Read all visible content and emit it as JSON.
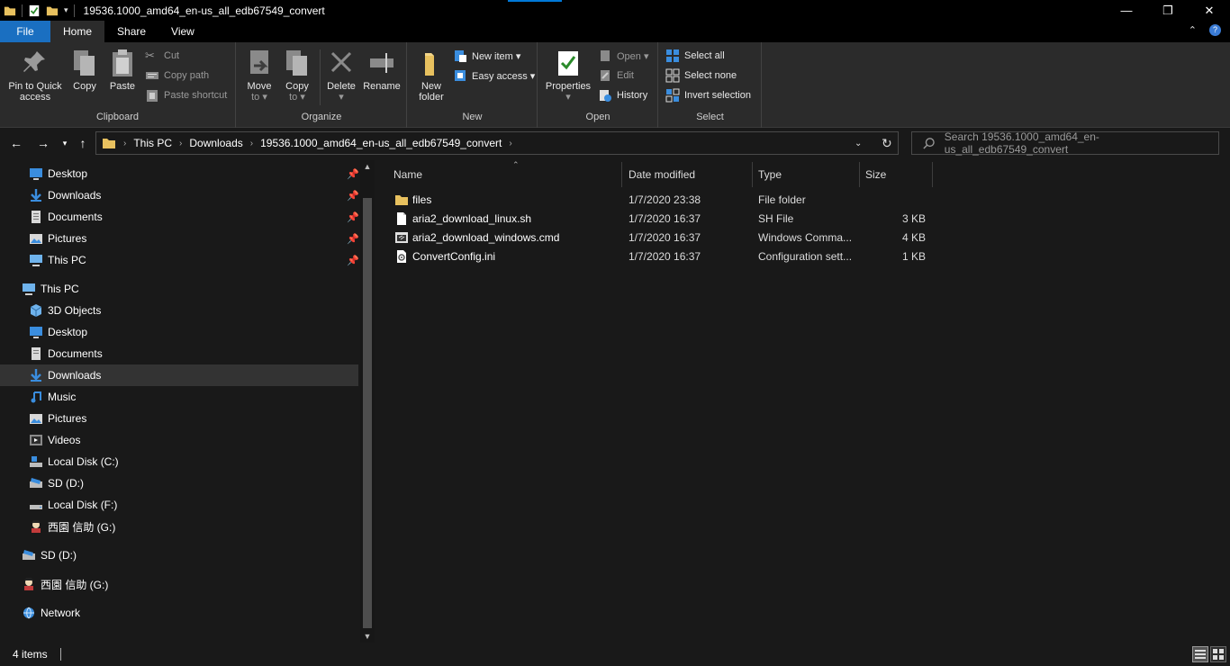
{
  "window": {
    "title": "19536.1000_amd64_en-us_all_edb67549_convert",
    "minimize": "—",
    "maximize": "❐",
    "close": "✕"
  },
  "ribbon_tabs": [
    "File",
    "Home",
    "Share",
    "View"
  ],
  "ribbon": {
    "clipboard": {
      "label": "Clipboard",
      "pin": "Pin to Quick access",
      "pin_l1": "Pin to Quick",
      "pin_l2": "access",
      "copy": "Copy",
      "paste": "Paste",
      "cut": "Cut",
      "copy_path": "Copy path",
      "paste_shortcut": "Paste shortcut"
    },
    "organize": {
      "label": "Organize",
      "move_l1": "Move",
      "move_l2": "to ▾",
      "copy_l1": "Copy",
      "copy_l2": "to ▾",
      "delete_l1": "Delete",
      "delete_l2": "▾",
      "rename": "Rename"
    },
    "new": {
      "label": "New",
      "folder_l1": "New",
      "folder_l2": "folder",
      "new_item": "New item ▾",
      "easy_access": "Easy access ▾"
    },
    "open": {
      "label": "Open",
      "properties_l1": "Properties",
      "properties_l2": "▾",
      "open": "Open ▾",
      "edit": "Edit",
      "history": "History"
    },
    "select": {
      "label": "Select",
      "select_all": "Select all",
      "select_none": "Select none",
      "invert": "Invert selection"
    }
  },
  "address": {
    "crumbs": [
      "This PC",
      "Downloads",
      "19536.1000_amd64_en-us_all_edb67549_convert"
    ],
    "search_placeholder": "Search 19536.1000_amd64_en-us_all_edb67549_convert"
  },
  "nav_pane": {
    "quick_access": [
      {
        "label": "Desktop",
        "icon": "desktop-icon"
      },
      {
        "label": "Downloads",
        "icon": "download-icon"
      },
      {
        "label": "Documents",
        "icon": "document-icon"
      },
      {
        "label": "Pictures",
        "icon": "pictures-icon"
      },
      {
        "label": "This PC",
        "icon": "computer-icon"
      }
    ],
    "this_pc": "This PC",
    "this_pc_items": [
      {
        "label": "3D Objects",
        "icon": "cube-icon"
      },
      {
        "label": "Desktop",
        "icon": "desktop-icon"
      },
      {
        "label": "Documents",
        "icon": "document-icon"
      },
      {
        "label": "Downloads",
        "icon": "download-icon"
      },
      {
        "label": "Music",
        "icon": "music-icon"
      },
      {
        "label": "Pictures",
        "icon": "pictures-icon"
      },
      {
        "label": "Videos",
        "icon": "video-icon"
      },
      {
        "label": "Local Disk (C:)",
        "icon": "drive-icon"
      },
      {
        "label": "SD (D:)",
        "icon": "sd-drive-icon"
      },
      {
        "label": "Local Disk (F:)",
        "icon": "drive-icon"
      },
      {
        "label": "西園 信助 (G:)",
        "icon": "custom-drive-icon"
      }
    ],
    "roots": [
      {
        "label": "SD (D:)",
        "icon": "sd-drive-icon"
      },
      {
        "label": "西園 信助 (G:)",
        "icon": "custom-drive-icon"
      },
      {
        "label": "Network",
        "icon": "network-icon"
      }
    ]
  },
  "file_list": {
    "columns": [
      "Name",
      "Date modified",
      "Type",
      "Size"
    ],
    "rows": [
      {
        "name": "files",
        "date": "1/7/2020 23:38",
        "type": "File folder",
        "size": "",
        "icon": "folder-icon"
      },
      {
        "name": "aria2_download_linux.sh",
        "date": "1/7/2020 16:37",
        "type": "SH File",
        "size": "3 KB",
        "icon": "file-icon"
      },
      {
        "name": "aria2_download_windows.cmd",
        "date": "1/7/2020 16:37",
        "type": "Windows Comma...",
        "size": "4 KB",
        "icon": "cmd-file-icon"
      },
      {
        "name": "ConvertConfig.ini",
        "date": "1/7/2020 16:37",
        "type": "Configuration sett...",
        "size": "1 KB",
        "icon": "config-file-icon"
      }
    ]
  },
  "status": {
    "item_count": "4 items"
  },
  "colors": {
    "accent": "#0078d7",
    "file_tab": "#1a6fc1",
    "folder": "#e8c15f",
    "background": "#191919"
  }
}
